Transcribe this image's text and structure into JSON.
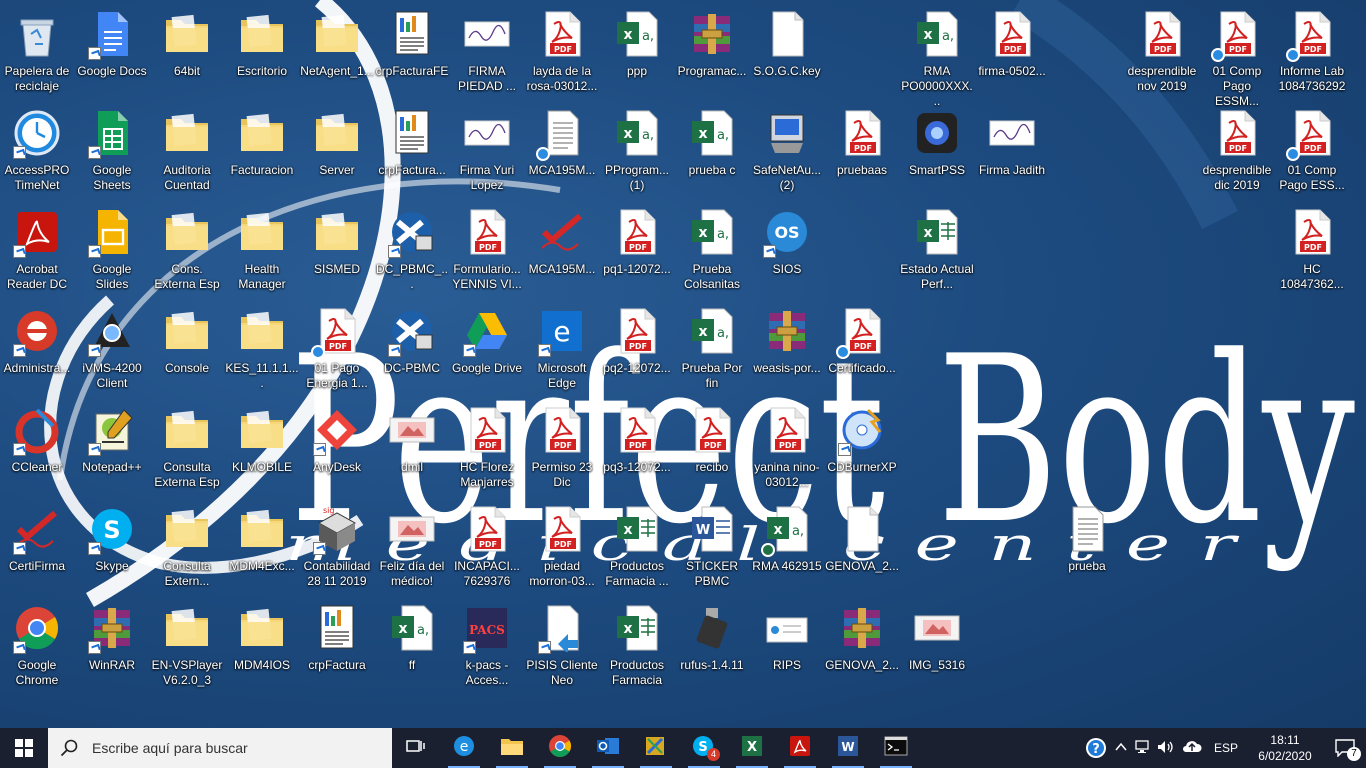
{
  "desktop": {
    "icons": [
      {
        "label": "Papelera de reciclaje",
        "type": "recycle",
        "col": 0,
        "row": 0,
        "sc": false
      },
      {
        "label": "Google Docs",
        "type": "gdocs",
        "col": 1,
        "row": 0,
        "sc": true
      },
      {
        "label": "64bit",
        "type": "folder",
        "col": 2,
        "row": 0,
        "sc": false
      },
      {
        "label": "Escritorio",
        "type": "folder",
        "col": 3,
        "row": 0,
        "sc": false
      },
      {
        "label": "NetAgent_1...",
        "type": "folder",
        "col": 4,
        "row": 0,
        "sc": false
      },
      {
        "label": "crpFacturaFE",
        "type": "report",
        "col": 5,
        "row": 0,
        "sc": false
      },
      {
        "label": "FIRMA PIEDAD ...",
        "type": "sign",
        "col": 6,
        "row": 0,
        "sc": false
      },
      {
        "label": "layda de la rosa-03012...",
        "type": "pdf",
        "col": 7,
        "row": 0,
        "sc": false
      },
      {
        "label": "ppp",
        "type": "excel",
        "col": 8,
        "row": 0,
        "sc": false
      },
      {
        "label": "Programac...",
        "type": "rar",
        "col": 9,
        "row": 0,
        "sc": false
      },
      {
        "label": "S.O.G.C.key",
        "type": "blank",
        "col": 10,
        "row": 0,
        "sc": false
      },
      {
        "label": "RMA PO0000XXX...",
        "type": "excel",
        "col": 12,
        "row": 0,
        "sc": false
      },
      {
        "label": "firma-0502...",
        "type": "pdf",
        "col": 13,
        "row": 0,
        "sc": false
      },
      {
        "label": "desprendible nov 2019",
        "type": "pdf",
        "col": 15,
        "row": 0,
        "sc": false
      },
      {
        "label": "01 Comp Pago ESSM...",
        "type": "pdf",
        "col": 16,
        "row": 0,
        "sc": false,
        "sync": true
      },
      {
        "label": "Informe Lab 1084736292",
        "type": "pdf",
        "col": 17,
        "row": 0,
        "sc": false,
        "sync": true
      },
      {
        "label": "AccessPRO TimeNet",
        "type": "clock",
        "col": 0,
        "row": 1,
        "sc": true
      },
      {
        "label": "Google Sheets",
        "type": "gsheets",
        "col": 1,
        "row": 1,
        "sc": true
      },
      {
        "label": "Auditoria Cuentad",
        "type": "folder",
        "col": 2,
        "row": 1,
        "sc": false
      },
      {
        "label": "Facturacion",
        "type": "folder",
        "col": 3,
        "row": 1,
        "sc": false
      },
      {
        "label": "Server",
        "type": "folder",
        "col": 4,
        "row": 1,
        "sc": false
      },
      {
        "label": "crpFactura...",
        "type": "report",
        "col": 5,
        "row": 1,
        "sc": false
      },
      {
        "label": "Firma Yuri Lopez",
        "type": "sign",
        "col": 6,
        "row": 1,
        "sc": false
      },
      {
        "label": "MCA195M...",
        "type": "doc",
        "col": 7,
        "row": 1,
        "sc": false,
        "sync": true
      },
      {
        "label": "PProgram... (1)",
        "type": "excel",
        "col": 8,
        "row": 1,
        "sc": false
      },
      {
        "label": "prueba c",
        "type": "excel",
        "col": 9,
        "row": 1,
        "sc": false
      },
      {
        "label": "SafeNetAu... (2)",
        "type": "installer",
        "col": 10,
        "row": 1,
        "sc": false
      },
      {
        "label": "pruebaas",
        "type": "pdf",
        "col": 11,
        "row": 1,
        "sc": false
      },
      {
        "label": "SmartPSS",
        "type": "camera",
        "col": 12,
        "row": 1,
        "sc": false
      },
      {
        "label": "Firma Jadith",
        "type": "sign",
        "col": 13,
        "row": 1,
        "sc": false
      },
      {
        "label": "desprendible dic 2019",
        "type": "pdf",
        "col": 16,
        "row": 1,
        "sc": false
      },
      {
        "label": "01 Comp Pago ESS...",
        "type": "pdf",
        "col": 17,
        "row": 1,
        "sc": false,
        "sync": true
      },
      {
        "label": "Acrobat Reader DC",
        "type": "acrobat",
        "col": 0,
        "row": 2,
        "sc": true
      },
      {
        "label": "Google Slides",
        "type": "gslides",
        "col": 1,
        "row": 2,
        "sc": true
      },
      {
        "label": "Cons. Externa Esp",
        "type": "folder",
        "col": 2,
        "row": 2,
        "sc": false
      },
      {
        "label": "Health Manager",
        "type": "folder",
        "col": 3,
        "row": 2,
        "sc": false
      },
      {
        "label": "SISMED",
        "type": "folder",
        "col": 4,
        "row": 2,
        "sc": false
      },
      {
        "label": "DC_PBMC_...",
        "type": "remote",
        "col": 5,
        "row": 2,
        "sc": true
      },
      {
        "label": "Formulario... YENNIS VI...",
        "type": "pdf",
        "col": 6,
        "row": 2,
        "sc": false
      },
      {
        "label": "MCA195M...",
        "type": "certifirma",
        "col": 7,
        "row": 2,
        "sc": false
      },
      {
        "label": "pq1-12072...",
        "type": "pdf",
        "col": 8,
        "row": 2,
        "sc": false
      },
      {
        "label": "Prueba Colsanitas",
        "type": "excel",
        "col": 9,
        "row": 2,
        "sc": false
      },
      {
        "label": "SIOS",
        "type": "sios",
        "col": 10,
        "row": 2,
        "sc": true
      },
      {
        "label": "Estado Actual Perf...",
        "type": "excelx",
        "col": 12,
        "row": 2,
        "sc": false
      },
      {
        "label": "HC 10847362...",
        "type": "pdf",
        "col": 17,
        "row": 2,
        "sc": false
      },
      {
        "label": "Administra...",
        "type": "admin",
        "col": 0,
        "row": 3,
        "sc": true
      },
      {
        "label": "iVMS-4200 Client",
        "type": "ivms",
        "col": 1,
        "row": 3,
        "sc": true
      },
      {
        "label": "Console",
        "type": "folder",
        "col": 2,
        "row": 3,
        "sc": false
      },
      {
        "label": "KES_11.1.1....",
        "type": "folder",
        "col": 3,
        "row": 3,
        "sc": false
      },
      {
        "label": "01 Pago Energia 1...",
        "type": "pdf",
        "col": 4,
        "row": 3,
        "sc": false,
        "sync": true
      },
      {
        "label": "DC-PBMC",
        "type": "remote",
        "col": 5,
        "row": 3,
        "sc": true
      },
      {
        "label": "Google Drive",
        "type": "gdrive",
        "col": 6,
        "row": 3,
        "sc": true
      },
      {
        "label": "Microsoft Edge",
        "type": "edge",
        "col": 7,
        "row": 3,
        "sc": true
      },
      {
        "label": "pq2-12072...",
        "type": "pdf",
        "col": 8,
        "row": 3,
        "sc": false
      },
      {
        "label": "Prueba Por fin",
        "type": "excel",
        "col": 9,
        "row": 3,
        "sc": false
      },
      {
        "label": "weasis-por...",
        "type": "rar",
        "col": 10,
        "row": 3,
        "sc": false
      },
      {
        "label": "Certificado...",
        "type": "pdf",
        "col": 11,
        "row": 3,
        "sc": false,
        "sync": true
      },
      {
        "label": "CCleaner",
        "type": "ccleaner",
        "col": 0,
        "row": 4,
        "sc": true
      },
      {
        "label": "Notepad++",
        "type": "notepad",
        "col": 1,
        "row": 4,
        "sc": true
      },
      {
        "label": "Consulta Externa Esp",
        "type": "folder",
        "col": 2,
        "row": 4,
        "sc": false
      },
      {
        "label": "KLMOBILE",
        "type": "folder",
        "col": 3,
        "row": 4,
        "sc": false
      },
      {
        "label": "AnyDesk",
        "type": "anydesk",
        "col": 4,
        "row": 4,
        "sc": true
      },
      {
        "label": "dmil",
        "type": "image",
        "col": 5,
        "row": 4,
        "sc": false
      },
      {
        "label": "HC Florez Manjarres",
        "type": "pdf",
        "col": 6,
        "row": 4,
        "sc": false
      },
      {
        "label": "Permiso 23 Dic",
        "type": "pdf",
        "col": 7,
        "row": 4,
        "sc": false
      },
      {
        "label": "pq3-12072...",
        "type": "pdf",
        "col": 8,
        "row": 4,
        "sc": false
      },
      {
        "label": "recibo",
        "type": "pdf",
        "col": 9,
        "row": 4,
        "sc": false
      },
      {
        "label": "yanina nino-03012...",
        "type": "pdf",
        "col": 10,
        "row": 4,
        "sc": false
      },
      {
        "label": "CDBurnerXP",
        "type": "cdburner",
        "col": 11,
        "row": 4,
        "sc": true
      },
      {
        "label": "CertiFirma",
        "type": "certifirma",
        "col": 0,
        "row": 5,
        "sc": true
      },
      {
        "label": "Skype",
        "type": "skype",
        "col": 1,
        "row": 5,
        "sc": true
      },
      {
        "label": "Consulta Extern...",
        "type": "folder",
        "col": 2,
        "row": 5,
        "sc": false
      },
      {
        "label": "MDM4Exc...",
        "type": "folder",
        "col": 3,
        "row": 5,
        "sc": false
      },
      {
        "label": "Contabilidad 28 11 2019",
        "type": "siigo",
        "col": 4,
        "row": 5,
        "sc": true
      },
      {
        "label": "Feliz día del médico!",
        "type": "image",
        "col": 5,
        "row": 5,
        "sc": false
      },
      {
        "label": "INCAPACI... 7629376",
        "type": "pdf",
        "col": 6,
        "row": 5,
        "sc": false
      },
      {
        "label": "piedad morron-03...",
        "type": "pdf",
        "col": 7,
        "row": 5,
        "sc": false
      },
      {
        "label": "Productos Farmacia ...",
        "type": "excelx",
        "col": 8,
        "row": 5,
        "sc": false
      },
      {
        "label": "STICKER PBMC",
        "type": "word",
        "col": 9,
        "row": 5,
        "sc": false
      },
      {
        "label": "RMA 462915",
        "type": "excel",
        "col": 10,
        "row": 5,
        "sc": false,
        "warn": true
      },
      {
        "label": "GENOVA_2...",
        "type": "blank",
        "col": 11,
        "row": 5,
        "sc": false
      },
      {
        "label": "prueba",
        "type": "doc",
        "col": 14,
        "row": 5,
        "sc": false
      },
      {
        "label": "Google Chrome",
        "type": "chrome",
        "col": 0,
        "row": 6,
        "sc": true
      },
      {
        "label": "WinRAR",
        "type": "rar",
        "col": 1,
        "row": 6,
        "sc": true
      },
      {
        "label": "EN-VSPlayer V6.2.0_3",
        "type": "folder",
        "col": 2,
        "row": 6,
        "sc": false
      },
      {
        "label": "MDM4IOS",
        "type": "folder",
        "col": 3,
        "row": 6,
        "sc": false
      },
      {
        "label": "crpFactura",
        "type": "report",
        "col": 4,
        "row": 6,
        "sc": false
      },
      {
        "label": "ff",
        "type": "excel",
        "col": 5,
        "row": 6,
        "sc": false
      },
      {
        "label": "k-pacs - Acces...",
        "type": "kpacs",
        "col": 6,
        "row": 6,
        "sc": true
      },
      {
        "label": "PISIS Cliente Neo",
        "type": "pisis",
        "col": 7,
        "row": 6,
        "sc": true
      },
      {
        "label": "Productos Farmacia",
        "type": "excelx",
        "col": 8,
        "row": 6,
        "sc": false
      },
      {
        "label": "rufus-1.4.11",
        "type": "usb",
        "col": 9,
        "row": 6,
        "sc": false
      },
      {
        "label": "RIPS",
        "type": "rips",
        "col": 10,
        "row": 6,
        "sc": false
      },
      {
        "label": "GENOVA_2...",
        "type": "rar",
        "col": 11,
        "row": 6,
        "sc": false
      },
      {
        "label": "IMG_5316",
        "type": "image",
        "col": 12,
        "row": 6,
        "sc": false
      }
    ]
  },
  "wallpaper": {
    "brand_title": "Perfect Body",
    "brand_subtitle": "medical center"
  },
  "taskbar": {
    "search_placeholder": "Escribe aquí para buscar",
    "apps": [
      "task-view",
      "edge",
      "file-explorer",
      "chrome",
      "outlook",
      "network-tool",
      "skype",
      "excel",
      "acrobat",
      "word",
      "cmd"
    ],
    "skype_badge": "4",
    "language": "ESP",
    "time": "18:11",
    "date": "6/02/2020",
    "notification_count": "7"
  }
}
